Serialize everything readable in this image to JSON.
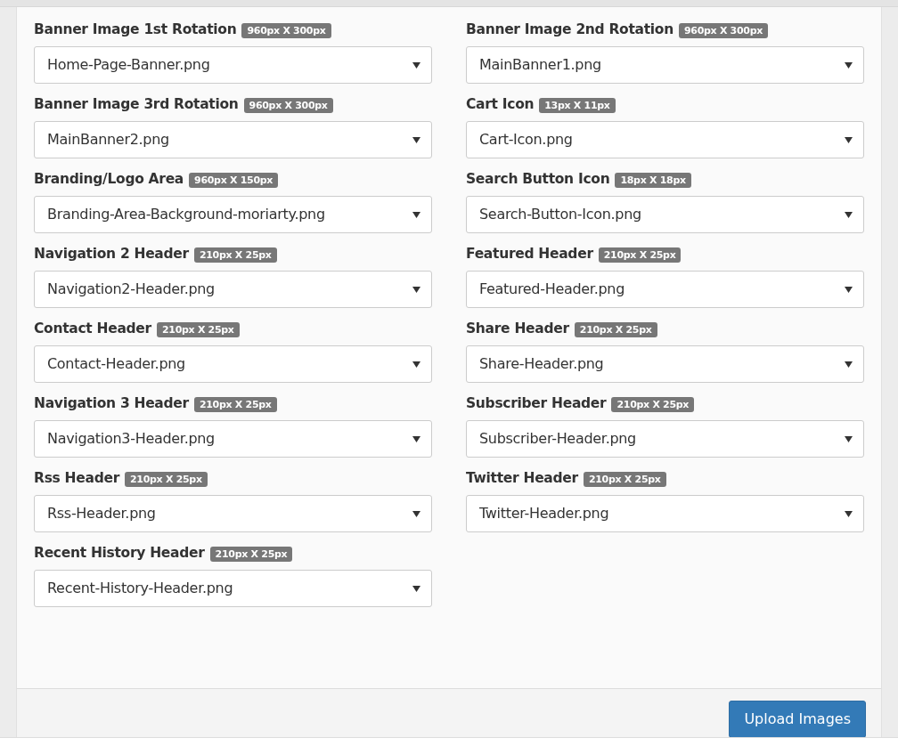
{
  "fields": [
    {
      "label": "Banner Image 1st Rotation",
      "size": "960px X 300px",
      "value": "Home-Page-Banner.png"
    },
    {
      "label": "Banner Image 2nd Rotation",
      "size": "960px X 300px",
      "value": "MainBanner1.png"
    },
    {
      "label": "Banner Image 3rd Rotation",
      "size": "960px X 300px",
      "value": "MainBanner2.png"
    },
    {
      "label": "Cart Icon",
      "size": "13px X 11px",
      "value": "Cart-Icon.png"
    },
    {
      "label": "Branding/Logo Area",
      "size": "960px X 150px",
      "value": "Branding-Area-Background-moriarty.png"
    },
    {
      "label": "Search Button Icon",
      "size": "18px X 18px",
      "value": "Search-Button-Icon.png"
    },
    {
      "label": "Navigation 2 Header",
      "size": "210px X 25px",
      "value": "Navigation2-Header.png"
    },
    {
      "label": "Featured Header",
      "size": "210px X 25px",
      "value": "Featured-Header.png"
    },
    {
      "label": "Contact Header",
      "size": "210px X 25px",
      "value": "Contact-Header.png"
    },
    {
      "label": "Share Header",
      "size": "210px X 25px",
      "value": "Share-Header.png"
    },
    {
      "label": "Navigation 3 Header",
      "size": "210px X 25px",
      "value": "Navigation3-Header.png"
    },
    {
      "label": "Subscriber Header",
      "size": "210px X 25px",
      "value": "Subscriber-Header.png"
    },
    {
      "label": "Rss Header",
      "size": "210px X 25px",
      "value": "Rss-Header.png"
    },
    {
      "label": "Twitter Header",
      "size": "210px X 25px",
      "value": "Twitter-Header.png"
    },
    {
      "label": "Recent History Header",
      "size": "210px X 25px",
      "value": "Recent-History-Header.png"
    }
  ],
  "submit_button": "Upload Images"
}
